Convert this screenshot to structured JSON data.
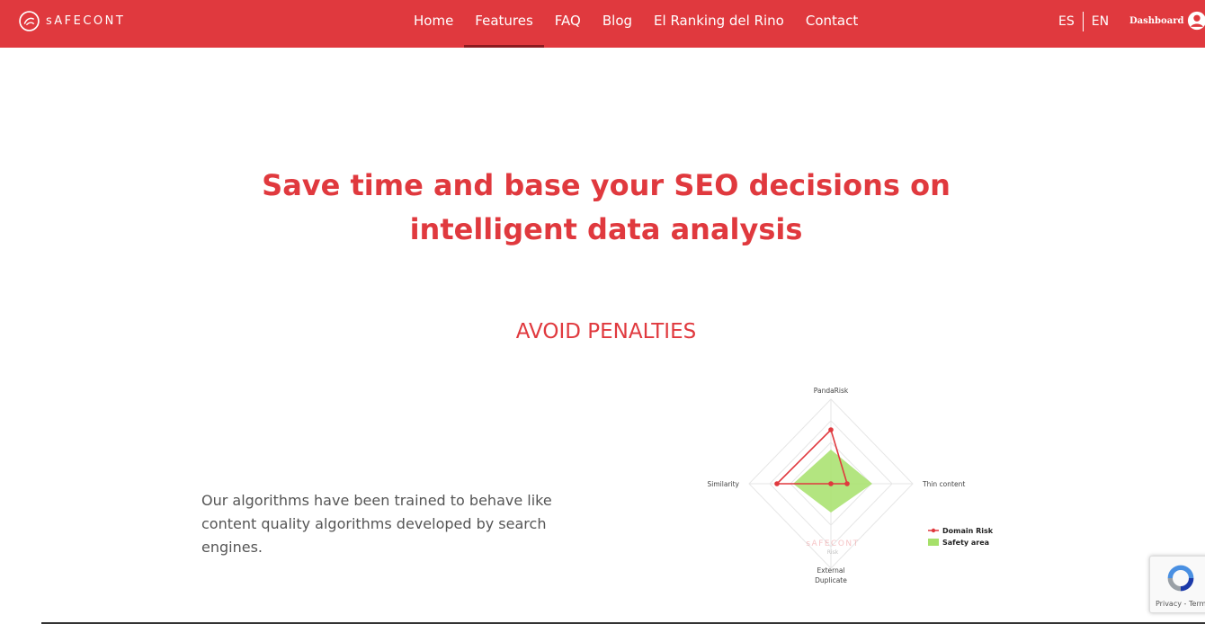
{
  "header": {
    "logo_text": "sAFECONT",
    "nav": [
      {
        "label": "Home"
      },
      {
        "label": "Features"
      },
      {
        "label": "FAQ"
      },
      {
        "label": "Blog"
      },
      {
        "label": "El Ranking del Rino"
      },
      {
        "label": "Contact"
      }
    ],
    "active_nav": "Features",
    "lang": {
      "es": "ES",
      "en": "EN"
    },
    "dashboard_label": "Dashboard"
  },
  "hero": {
    "line1": "Save time and base your SEO decisions on",
    "line2": "intelligent data analysis"
  },
  "section": {
    "title": "AVOID PENALTIES",
    "description": "Our algorithms have been trained to behave like content quality algorithms developed by search engines."
  },
  "radar": {
    "axes": [
      "PandaRisk",
      "Thin content",
      "External Duplicate",
      "Similarity"
    ],
    "watermark": "sAFECONT",
    "watermark_sub": "Risk",
    "legend": [
      {
        "label": "Domain Risk",
        "color": "#e0393e"
      },
      {
        "label": "Safety area",
        "color": "#a6e06a"
      }
    ]
  },
  "recaptcha": {
    "links": "Privacy - Terms"
  },
  "colors": {
    "brand": "#e0393e",
    "safety": "#a6e06a"
  },
  "icons": {
    "logo": "safecont-logo-icon",
    "user": "user-icon",
    "recaptcha": "recaptcha-icon"
  }
}
